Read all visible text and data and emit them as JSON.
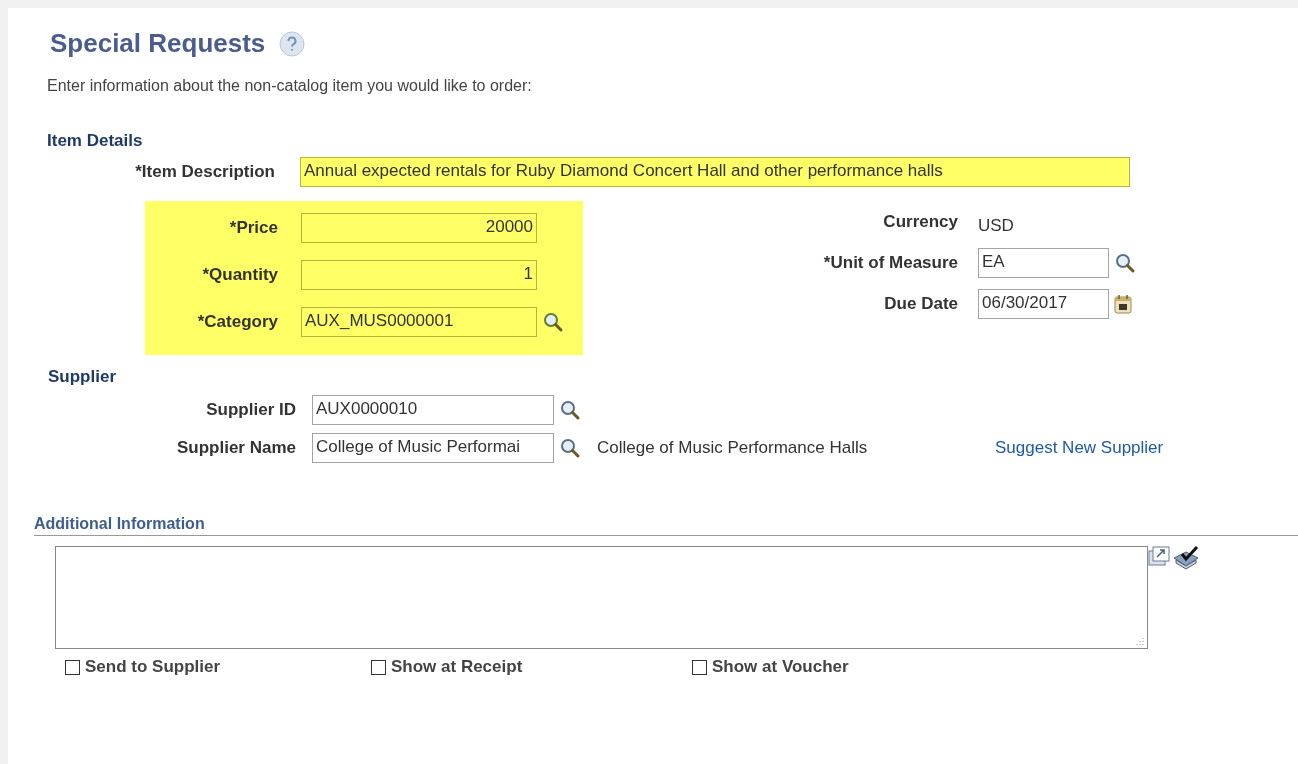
{
  "page": {
    "title": "Special Requests",
    "intro": "Enter information about the non-catalog item you would like to order:"
  },
  "item_details": {
    "heading": "Item Details",
    "description": {
      "label": "*Item Description",
      "value": "Annual expected rentals for Ruby Diamond Concert Hall and other performance halls",
      "highlighted": true
    },
    "left_highlighted": true,
    "left_fields": [
      {
        "label": "*Price",
        "value": "20000",
        "kind": "number"
      },
      {
        "label": "*Quantity",
        "value": "1",
        "kind": "number"
      },
      {
        "label": "*Category",
        "value": "AUX_MUS0000001",
        "kind": "lookup"
      }
    ],
    "currency": {
      "label": "Currency",
      "value": "USD"
    },
    "unit_of_measure": {
      "label": "*Unit of Measure",
      "value": "EA"
    },
    "due_date": {
      "label": "Due Date",
      "value": "06/30/2017"
    }
  },
  "supplier": {
    "heading": "Supplier",
    "supplier_id": {
      "label": "Supplier ID",
      "value": "AUX0000010"
    },
    "supplier_name": {
      "label": "Supplier Name",
      "value": "College of Music Performai",
      "display": "College of Music Performance Halls"
    },
    "link": "Suggest New Supplier"
  },
  "additional_information": {
    "heading": "Additional Information",
    "checkboxes": [
      {
        "label": "Send to Supplier",
        "checked": false
      },
      {
        "label": "Show at Receipt",
        "checked": false
      },
      {
        "label": "Show at Voucher",
        "checked": false
      }
    ]
  }
}
